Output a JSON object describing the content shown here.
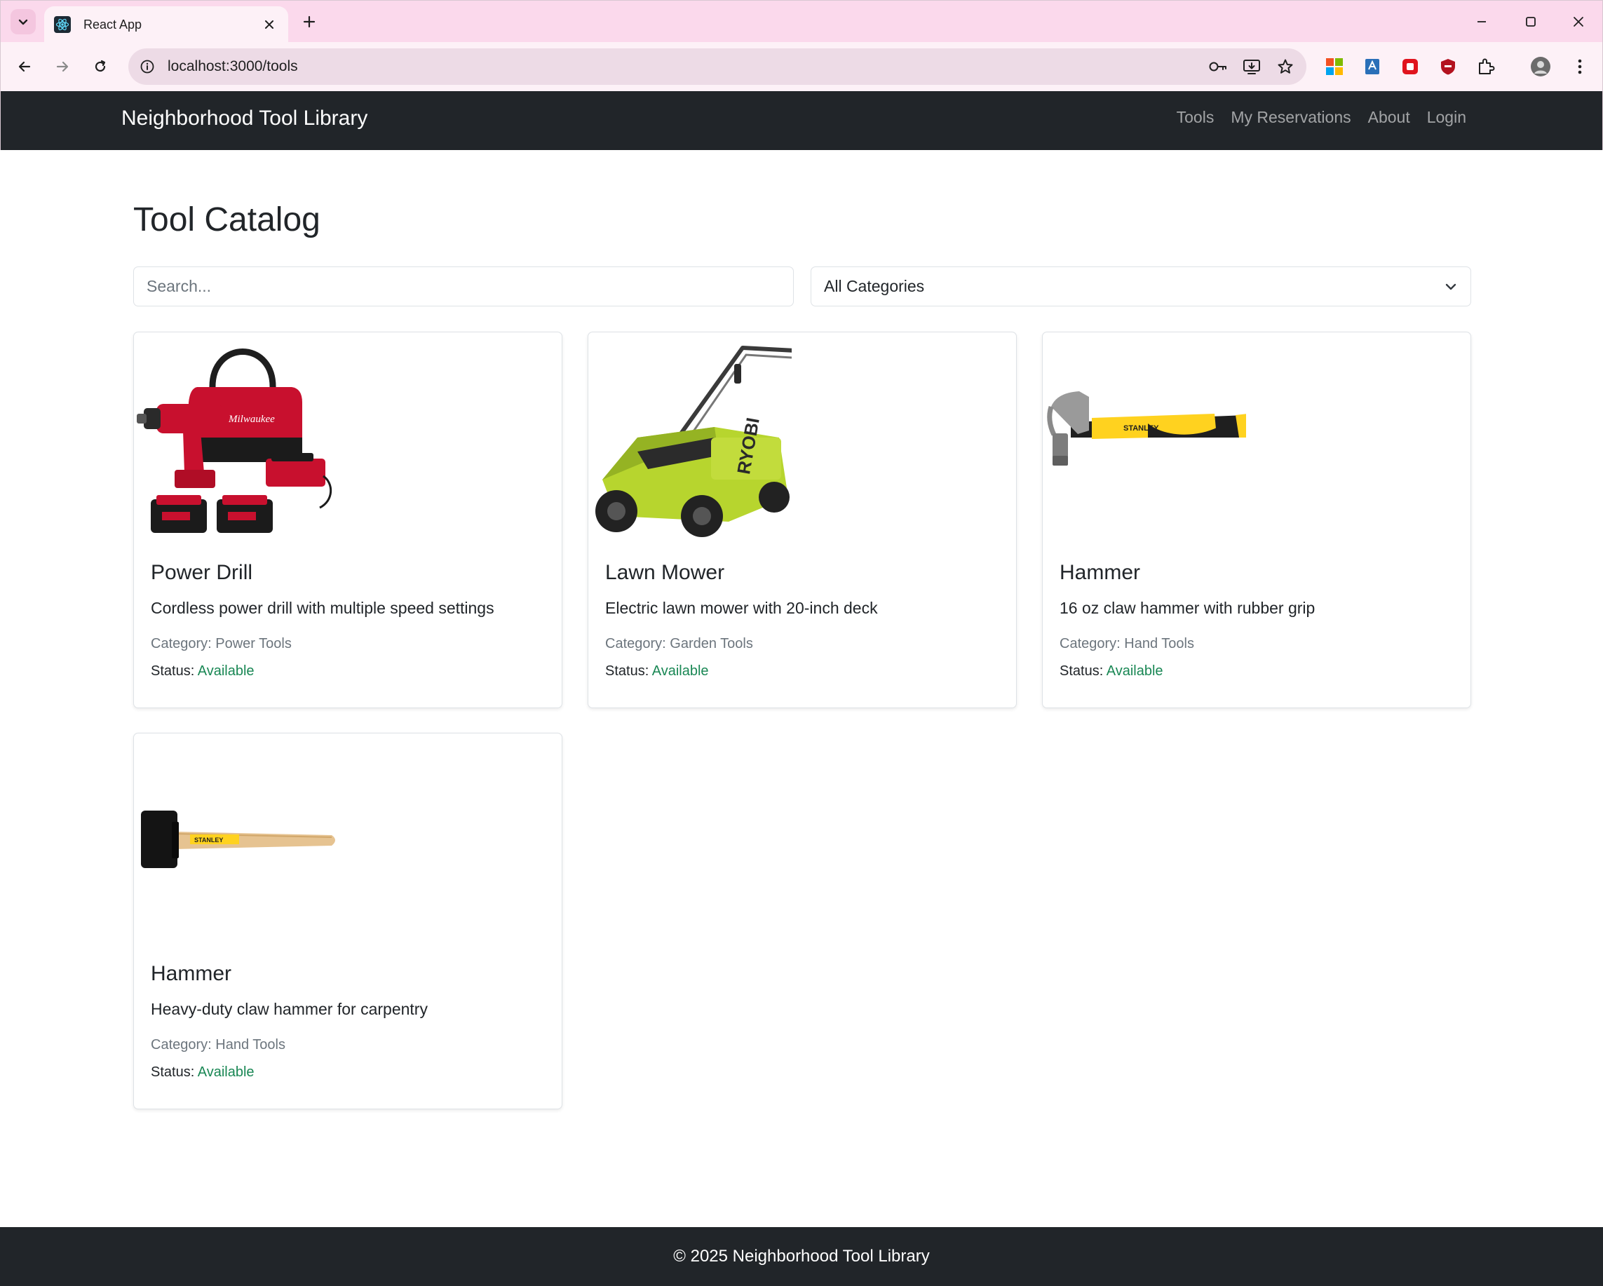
{
  "browser": {
    "tab_title": "React App",
    "url": "localhost:3000/tools"
  },
  "navbar": {
    "brand": "Neighborhood Tool Library",
    "links": [
      "Tools",
      "My Reservations",
      "About",
      "Login"
    ]
  },
  "main": {
    "title": "Tool Catalog",
    "search_placeholder": "Search...",
    "category_selected": "All Categories"
  },
  "tools": [
    {
      "name": "Power Drill",
      "description": "Cordless power drill with multiple speed settings",
      "category": "Category: Power Tools",
      "status_label": "Status:",
      "status": "Available",
      "image": "power-drill-kit"
    },
    {
      "name": "Lawn Mower",
      "description": "Electric lawn mower with 20-inch deck",
      "category": "Category: Garden Tools",
      "status_label": "Status:",
      "status": "Available",
      "image": "lawn-mower"
    },
    {
      "name": "Hammer",
      "description": "16 oz claw hammer with rubber grip",
      "category": "Category: Hand Tools",
      "status_label": "Status:",
      "status": "Available",
      "image": "claw-hammer"
    },
    {
      "name": "Hammer",
      "description": "Heavy-duty claw hammer for carpentry",
      "category": "Category: Hand Tools",
      "status_label": "Status:",
      "status": "Available",
      "image": "rubber-mallet"
    }
  ],
  "footer": {
    "text": "© 2025 Neighborhood Tool Library"
  },
  "colors": {
    "navbar_bg": "#212529",
    "status_available": "#198754",
    "tabstrip_bg": "#fbd9ec"
  }
}
